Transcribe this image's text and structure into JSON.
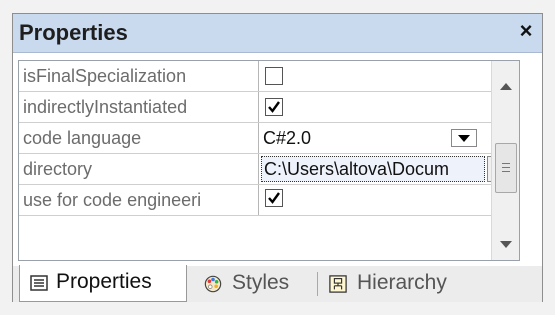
{
  "panel": {
    "title": "Properties",
    "close": "×"
  },
  "properties": [
    {
      "name": "isFinalSpecialization",
      "type": "checkbox",
      "checked": false
    },
    {
      "name": "indirectlyInstantiated",
      "type": "checkbox",
      "checked": true
    },
    {
      "name": "code language",
      "type": "dropdown",
      "value": "C#2.0"
    },
    {
      "name": "directory",
      "type": "path",
      "value": "C:\\Users\\altova\\Docum",
      "browse": "..."
    },
    {
      "name": "use for code engineeri",
      "type": "checkbox",
      "checked": true
    }
  ],
  "tabs": [
    {
      "label": "Properties",
      "icon": "properties-icon",
      "active": true
    },
    {
      "label": "Styles",
      "icon": "palette-icon",
      "active": false
    },
    {
      "label": "Hierarchy",
      "icon": "hierarchy-icon",
      "active": false
    }
  ]
}
